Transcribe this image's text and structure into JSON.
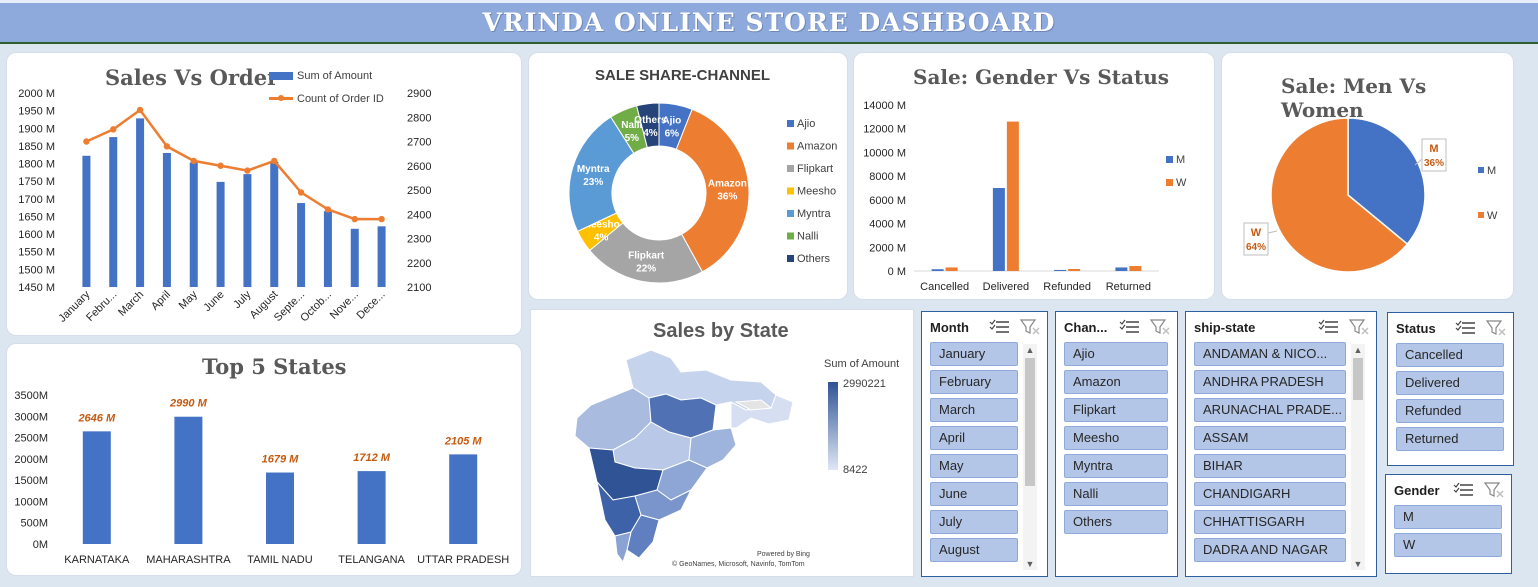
{
  "dashboard": {
    "title": "VRINDA ONLINE STORE DASHBOARD"
  },
  "colors": {
    "blue": "#4472c4",
    "orange": "#ed7d31",
    "gray": "#a5a5a5",
    "gold": "#ffc000",
    "lightblue": "#5b9bd5",
    "green": "#70ad47",
    "navy": "#264478"
  },
  "sales_vs_order": {
    "title": "Sales Vs Order",
    "legend": [
      "Sum of Amount",
      "Count of Order ID"
    ]
  },
  "sale_share_channel": {
    "title": "SALE SHARE-CHANNEL"
  },
  "gender_status": {
    "title": "Sale: Gender Vs  Status"
  },
  "men_women": {
    "title": "Sale: Men Vs Women"
  },
  "top_states": {
    "title": "Top 5 States"
  },
  "sales_by_state": {
    "title": "Sales by State",
    "legend_title": "Sum of Amount",
    "legend_max": "2990221",
    "legend_min": "8422",
    "powered_by": "Powered by Bing",
    "attribution": "© GeoNames, Microsoft, Navinfo, TomTom"
  },
  "chart_data": [
    {
      "type": "bar",
      "title": "Sales Vs Order",
      "categories": [
        "January",
        "Febru...",
        "March",
        "April",
        "May",
        "June",
        "July",
        "August",
        "Septe...",
        "Octob...",
        "Nove...",
        "Dece..."
      ],
      "series": [
        {
          "name": "Sum of Amount",
          "axis": "left",
          "values": [
            1822,
            1875,
            1928,
            1830,
            1803,
            1748,
            1770,
            1805,
            1688,
            1665,
            1615,
            1622
          ]
        },
        {
          "name": "Count of Order ID",
          "type": "line",
          "axis": "right",
          "values": [
            2700,
            2750,
            2830,
            2680,
            2620,
            2600,
            2580,
            2620,
            2490,
            2420,
            2380,
            2380
          ]
        }
      ],
      "ylim": [
        1450,
        2000
      ],
      "y_ticks": [
        "2000 M",
        "1950 M",
        "1900 M",
        "1850 M",
        "1800 M",
        "1750 M",
        "1700 M",
        "1650 M",
        "1600 M",
        "1550 M",
        "1500 M",
        "1450 M"
      ],
      "y2lim": [
        2100,
        2900
      ],
      "y2_ticks": [
        "2900",
        "2800",
        "2700",
        "2600",
        "2500",
        "2400",
        "2300",
        "2200",
        "2100"
      ],
      "legend_position": "top-right"
    },
    {
      "type": "pie",
      "title": "SALE SHARE-CHANNEL",
      "categories": [
        "Ajio",
        "Amazon",
        "Flipkart",
        "Meesho",
        "Myntra",
        "Nalli",
        "Others"
      ],
      "values": [
        6,
        36,
        22,
        4,
        23,
        5,
        4
      ],
      "labels": [
        "6%",
        "36%",
        "22%",
        "4%",
        "23%",
        "5%",
        "4%"
      ],
      "legend_position": "right"
    },
    {
      "type": "bar",
      "title": "Sale: Gender Vs  Status",
      "categories": [
        "Cancelled",
        "Delivered",
        "Refunded",
        "Returned"
      ],
      "series": [
        {
          "name": "M",
          "values": [
            150,
            7000,
            90,
            300
          ]
        },
        {
          "name": "W",
          "values": [
            300,
            12600,
            170,
            420
          ]
        }
      ],
      "ylim": [
        0,
        14000
      ],
      "y_ticks": [
        "14000 M",
        "12000 M",
        "10000 M",
        "8000 M",
        "6000 M",
        "4000 M",
        "2000 M",
        "0 M"
      ],
      "legend_position": "right"
    },
    {
      "type": "pie",
      "title": "Sale: Men Vs Women",
      "categories": [
        "M",
        "W"
      ],
      "values": [
        36,
        64
      ],
      "labels": [
        "36%",
        "64%"
      ],
      "legend_position": "right"
    },
    {
      "type": "bar",
      "title": "Top 5 States",
      "categories": [
        "KARNATAKA",
        "MAHARASHTRA",
        "TAMIL NADU",
        "TELANGANA",
        "UTTAR PRADESH"
      ],
      "values": [
        2646,
        2990,
        1679,
        1712,
        2105
      ],
      "data_labels": [
        "2646 M",
        "2990 M",
        "1679 M",
        "1712 M",
        "2105 M"
      ],
      "ylim": [
        0,
        3500
      ],
      "y_ticks": [
        "3500M",
        "3000M",
        "2500M",
        "2000M",
        "1500M",
        "1000M",
        "500M",
        "0M"
      ]
    }
  ],
  "slicers": {
    "month": {
      "title": "Month",
      "items": [
        "January",
        "February",
        "March",
        "April",
        "May",
        "June",
        "July",
        "August"
      ]
    },
    "channel": {
      "title": "Chan...",
      "items": [
        "Ajio",
        "Amazon",
        "Flipkart",
        "Meesho",
        "Myntra",
        "Nalli",
        "Others"
      ]
    },
    "ship_state": {
      "title": "ship-state",
      "items": [
        "ANDAMAN & NICO...",
        "ANDHRA PRADESH",
        "ARUNACHAL PRADE...",
        "ASSAM",
        "BIHAR",
        "CHANDIGARH",
        "CHHATTISGARH",
        "DADRA AND NAGAR"
      ]
    },
    "status": {
      "title": "Status",
      "items": [
        "Cancelled",
        "Delivered",
        "Refunded",
        "Returned"
      ]
    },
    "gender": {
      "title": "Gender",
      "items": [
        "M",
        "W"
      ]
    }
  }
}
